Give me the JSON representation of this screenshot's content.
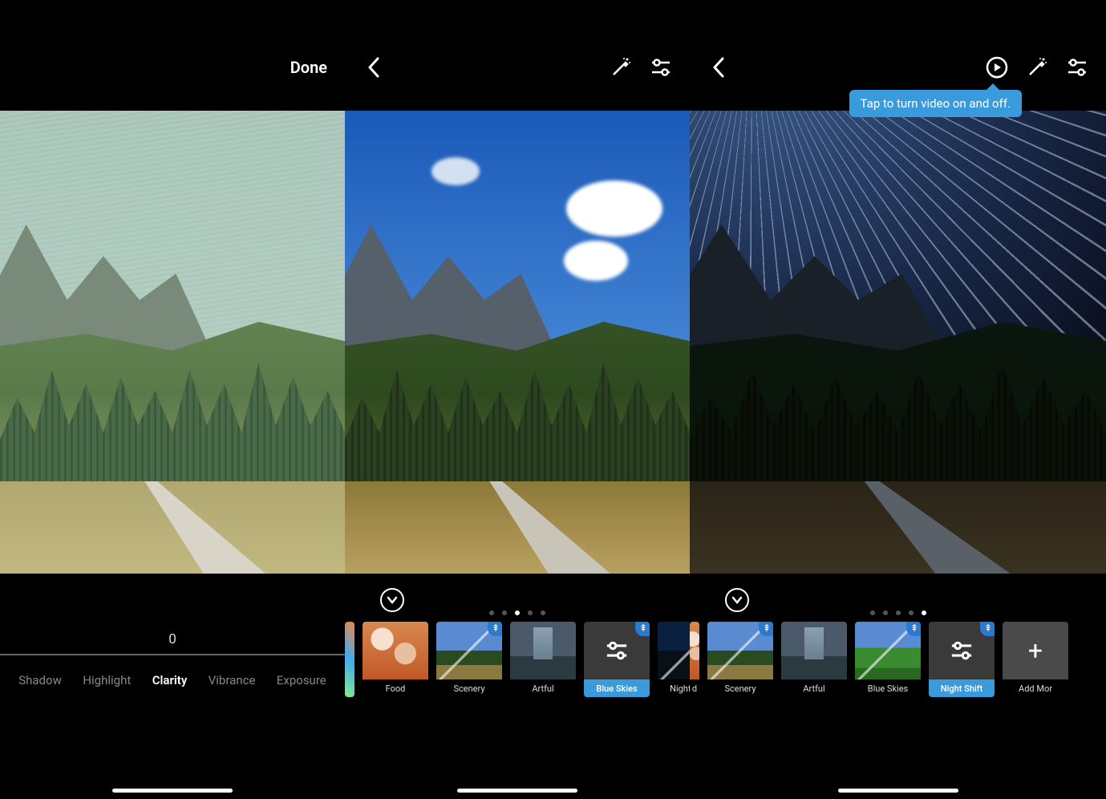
{
  "panel1": {
    "done_label": "Done",
    "slider_value": "0",
    "adjustments": [
      {
        "label": "Shadow",
        "active": false
      },
      {
        "label": "Highlight",
        "active": false
      },
      {
        "label": "Clarity",
        "active": true
      },
      {
        "label": "Vibrance",
        "active": false
      },
      {
        "label": "Exposure",
        "active": false
      }
    ]
  },
  "panel2": {
    "page_dots": {
      "count": 5,
      "active_index": 2
    },
    "filters": [
      {
        "label": "",
        "thumb": "partial",
        "badge": false,
        "selected": false
      },
      {
        "label": "Food",
        "thumb": "food",
        "badge": false,
        "selected": false
      },
      {
        "label": "Scenery",
        "thumb": "scenery",
        "badge": true,
        "selected": false
      },
      {
        "label": "Artful",
        "thumb": "artful",
        "badge": false,
        "selected": false
      },
      {
        "label": "Blue Skies",
        "thumb": "sliders",
        "badge": true,
        "selected": true
      },
      {
        "label": "Night Shift",
        "thumb": "nightshift",
        "badge": true,
        "selected": false
      }
    ]
  },
  "panel3": {
    "tooltip_text": "Tap to turn video on and off.",
    "page_dots": {
      "count": 5,
      "active_index": 4
    },
    "filters": [
      {
        "label": "d",
        "thumb": "partial",
        "badge": false,
        "selected": false
      },
      {
        "label": "Scenery",
        "thumb": "scenery",
        "badge": true,
        "selected": false
      },
      {
        "label": "Artful",
        "thumb": "artful",
        "badge": false,
        "selected": false
      },
      {
        "label": "Blue Skies",
        "thumb": "green",
        "badge": true,
        "selected": false
      },
      {
        "label": "Night Shift",
        "thumb": "sliders",
        "badge": true,
        "selected": true
      },
      {
        "label": "Add Mor",
        "thumb": "plus",
        "badge": false,
        "selected": false
      }
    ]
  }
}
